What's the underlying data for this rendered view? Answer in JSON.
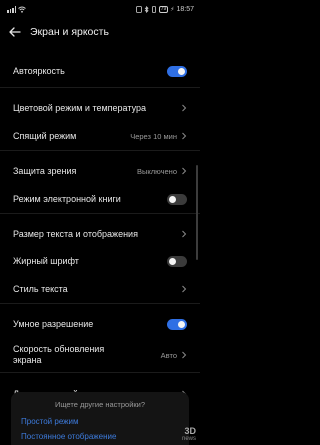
{
  "status": {
    "left_text": "",
    "right_text": "18:57",
    "battery": "79"
  },
  "header": {
    "title": "Экран и яркость"
  },
  "items": {
    "auto_brightness": {
      "label": "Автояркость",
      "toggle_on": true
    },
    "color_mode": {
      "label": "Цветовой режим и температура"
    },
    "sleep": {
      "label": "Спящий режим",
      "value": "Через 10 мин"
    },
    "eye_comfort": {
      "label": "Защита зрения",
      "value": "Выключено"
    },
    "ebook": {
      "label": "Режим электронной книги",
      "toggle_on": false
    },
    "text_size": {
      "label": "Размер текста и отображения"
    },
    "bold": {
      "label": "Жирный шрифт",
      "toggle_on": false
    },
    "text_style": {
      "label": "Стиль текста"
    },
    "smart_res": {
      "label": "Умное разрешение",
      "toggle_on": true
    },
    "refresh_rate": {
      "label_line1": "Скорость обновления",
      "label_line2": "экрана",
      "value": "Авто"
    },
    "other": {
      "label": "Другие настройки экрана"
    }
  },
  "suggestions": {
    "title": "Ищете другие настройки?",
    "links": [
      "Простой режим",
      "Постоянное отображение"
    ]
  },
  "watermark": {
    "line1": "3D",
    "line2": "news"
  },
  "colors": {
    "accent": "#2f6fe4",
    "link": "#3d7bdc",
    "background": "#000000"
  }
}
